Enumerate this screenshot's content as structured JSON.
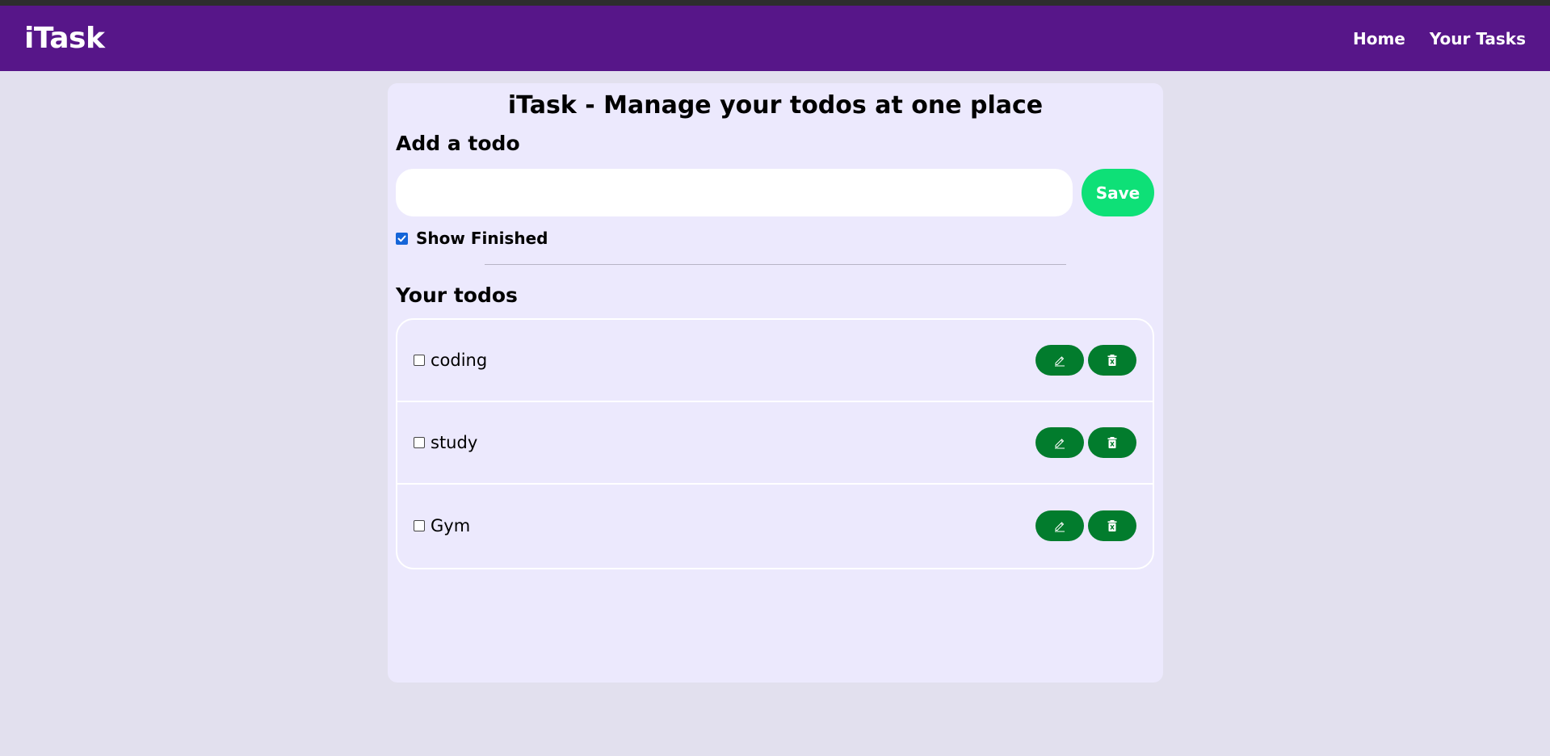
{
  "navbar": {
    "brand": "iTask",
    "links": [
      "Home",
      "Your Tasks"
    ]
  },
  "main": {
    "title": "iTask - Manage your todos at one place",
    "add_title": "Add a todo",
    "input_value": "",
    "save_label": "Save",
    "show_finished_label": "Show Finished",
    "show_finished_checked": true,
    "todos_title": "Your todos",
    "todos": [
      {
        "text": "coding",
        "done": false
      },
      {
        "text": "study",
        "done": false
      },
      {
        "text": "Gym",
        "done": false
      }
    ]
  },
  "colors": {
    "navbar": "#571689",
    "page_background": "#e2e0ee",
    "card_background": "#ece9fd",
    "save_button": "#0ee077",
    "action_button": "#027c2d"
  },
  "icons": {
    "edit": "pencil-icon",
    "delete": "trash-icon"
  }
}
